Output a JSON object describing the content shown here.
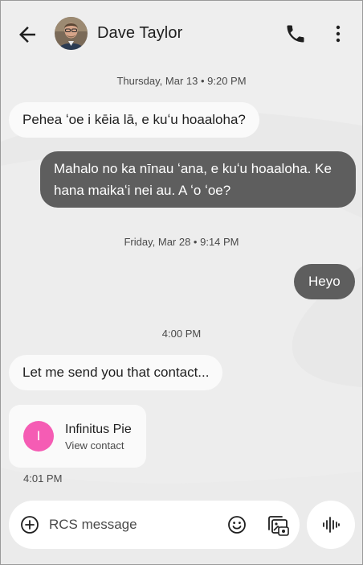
{
  "header": {
    "contact_name": "Dave Taylor",
    "back_icon": "arrow-back-icon",
    "call_icon": "phone-icon",
    "more_icon": "more-vert-icon"
  },
  "messages": [
    {
      "type": "timestamp",
      "text": "Thursday, Mar 13 • 9:20 PM"
    },
    {
      "type": "incoming",
      "text": "Pehea ʻoe i kēia lā, e kuʻu hoaaloha?"
    },
    {
      "type": "outgoing",
      "lines": [
        "Mahalo no ka nīnau ʻana, e kuʻu hoaaloha. Ke",
        "hana maikaʻi nei au. A ʻo ʻoe?"
      ]
    },
    {
      "type": "timestamp",
      "text": "Friday, Mar 28 • 9:14 PM"
    },
    {
      "type": "outgoing",
      "text": "Heyo"
    },
    {
      "type": "timestamp",
      "text": "4:00 PM"
    },
    {
      "type": "incoming",
      "text": "Let me send you that contact..."
    },
    {
      "type": "contact",
      "initial": "I",
      "name": "Infinitus Pie",
      "action": "View contact"
    },
    {
      "type": "time",
      "text": "4:01 PM"
    }
  ],
  "compose": {
    "placeholder": "RCS message",
    "add_icon": "add-circle-icon",
    "emoji_icon": "emoji-icon",
    "gallery_icon": "gallery-icon",
    "voice_icon": "voice-wave-icon"
  },
  "colors": {
    "background": "#eeeeee",
    "incoming_bubble": "#fafafa",
    "outgoing_bubble": "#5e5e5e",
    "contact_avatar": "#f55cb4"
  }
}
